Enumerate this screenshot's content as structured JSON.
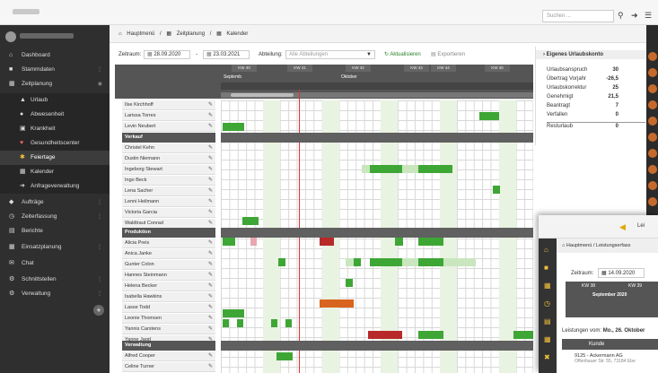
{
  "topbar": {
    "search_placeholder": "Suchen ..."
  },
  "sidebar": {
    "items": [
      {
        "label": "Dashboard",
        "icon": "house-icon"
      },
      {
        "label": "Stammdaten",
        "icon": "folder-icon"
      },
      {
        "label": "Zeitplanung",
        "icon": "calendar-icon"
      },
      {
        "label": "Urlaub",
        "icon": "plane-icon"
      },
      {
        "label": "Abwesenheit",
        "icon": "person-icon"
      },
      {
        "label": "Krankheit",
        "icon": "briefcase-icon"
      },
      {
        "label": "Gesundheitscenter",
        "icon": "heart-icon"
      },
      {
        "label": "Feiertage",
        "icon": "star-icon"
      },
      {
        "label": "Kalender",
        "icon": "calendar-icon"
      },
      {
        "label": "Anfrageverwaltung",
        "icon": "arrow-icon"
      },
      {
        "label": "Aufträge",
        "icon": "tag-icon"
      },
      {
        "label": "Zeiterfassung",
        "icon": "clock-icon"
      },
      {
        "label": "Berichte",
        "icon": "doc-icon"
      },
      {
        "label": "Einsatzplanung",
        "icon": "table-icon"
      },
      {
        "label": "Chat",
        "icon": "chat-icon"
      },
      {
        "label": "Schnittstellen",
        "icon": "plug-icon"
      },
      {
        "label": "Verwaltung",
        "icon": "gear-icon"
      }
    ]
  },
  "breadcrumb": {
    "home": "Hauptmenü",
    "sep": "/",
    "section": "Zeitplanung",
    "page": "Kalender"
  },
  "filter": {
    "zeitraum_label": "Zeitraum:",
    "from": "28.09.2020",
    "dash": "-",
    "to": "23.03.2021",
    "abteilung_label": "Abteilung:",
    "abteilung_value": "Alle Abteilungen",
    "aktualisieren": "Aktualisieren",
    "exportieren": "Exportieren"
  },
  "calendar": {
    "weeks": [
      "KW 40",
      "KW 41",
      "KW 42",
      "KW 43",
      "KW 44",
      "KW 45"
    ],
    "months": [
      "Septemb",
      "Oktober"
    ],
    "groups": [
      {
        "name": "",
        "people": [
          "Ilse Kirchhoff",
          "Larissa Torres",
          "Levin Neubert"
        ]
      },
      {
        "name": "Verkauf",
        "people": [
          "Christel Kehn",
          "Dustin Niemann",
          "Ingeborg Stewart",
          "Ingo Beck",
          "Lena Sacher",
          "Lenni Heilmann",
          "Victoria Garcia",
          "Waldtraut Conrad"
        ]
      },
      {
        "name": "Produktion",
        "people": [
          "Alicia Preis",
          "Anica Janke",
          "Gunter Colon",
          "Hannes Steinmann",
          "Helena Becker",
          "Isabella Hawkins",
          "Lasse Todd",
          "Leonie Thomsen",
          "Yannis Carstens",
          "Yanne Jagd"
        ]
      },
      {
        "name": "Verwaltung",
        "people": [
          "Alfred Cooper",
          "Celine Turner"
        ]
      }
    ]
  },
  "panel": {
    "title": "Eigenes Urlaubskonto",
    "rows": [
      {
        "label": "Urlaubsanspruch",
        "value": "30"
      },
      {
        "label": "Übertrag Vorjahr",
        "value": "-26,5"
      },
      {
        "label": "Urlaubskorrektur",
        "value": "25"
      },
      {
        "label": "Genehmigt",
        "value": "21,5"
      },
      {
        "label": "Beantragt",
        "value": "7"
      },
      {
        "label": "Verfallen",
        "value": "0"
      },
      {
        "label": "Resturlaub",
        "value": "0"
      }
    ]
  },
  "overlay": {
    "breadcrumb_home": "Hauptmenü",
    "breadcrumb_page": "Leistungserfass",
    "zeitraum_label": "Zeitraum:",
    "zeitraum_value": "14.09.2020",
    "kw1": "KW 38",
    "kw2": "KW 39",
    "month": "September 2020",
    "leistungen_label": "Leistungen vom:",
    "leistungen_date": "Mo., 26. Oktober",
    "kunde_label": "Kunde",
    "customer": "9125 - Ackermann AG",
    "customer_addr": "Offenbauer Str. 55, 73184 Ebe",
    "top_label": "Lei"
  }
}
